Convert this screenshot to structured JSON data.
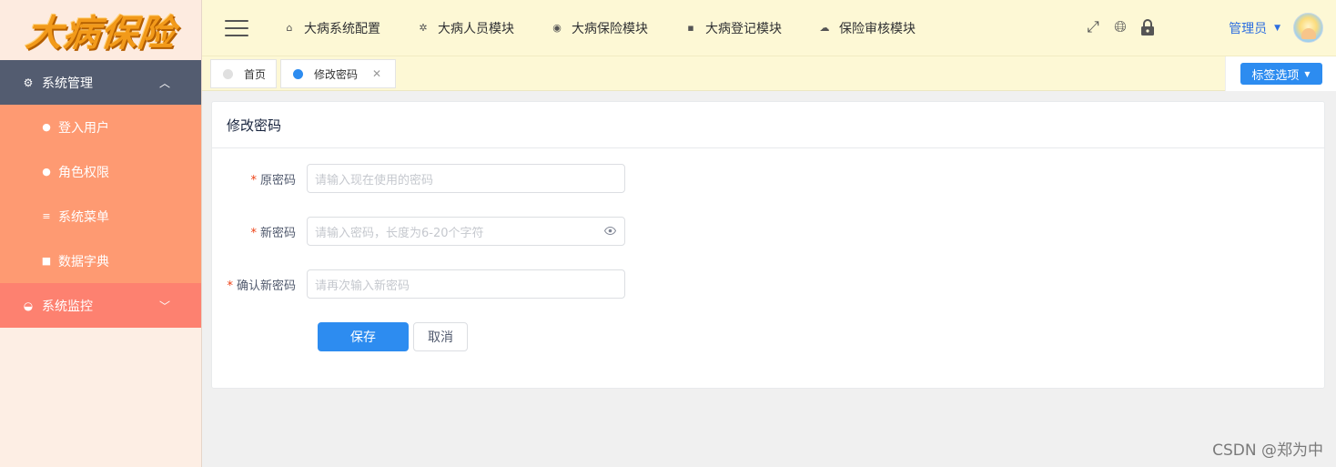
{
  "logo": {
    "text": "大病保险"
  },
  "sidebar": {
    "groups": [
      {
        "label": "系统管理",
        "icon": "gear-icon",
        "expanded": true,
        "items": [
          {
            "label": "登入用户",
            "icon": "user-icon"
          },
          {
            "label": "角色权限",
            "icon": "users-icon"
          },
          {
            "label": "系统菜单",
            "icon": "menu-lines-icon"
          },
          {
            "label": "数据字典",
            "icon": "book-icon"
          }
        ]
      },
      {
        "label": "系统监控",
        "icon": "monitor-dial-icon",
        "expanded": false
      }
    ]
  },
  "header": {
    "nav": [
      {
        "label": "大病系统配置",
        "icon": "home-icon"
      },
      {
        "label": "大病人员模块",
        "icon": "aperture-icon"
      },
      {
        "label": "大病保险模块",
        "icon": "at-circle-icon"
      },
      {
        "label": "大病登记模块",
        "icon": "book-icon"
      },
      {
        "label": "保险审核模块",
        "icon": "cloud-icon"
      }
    ],
    "tools": [
      "fullscreen-icon",
      "globe-icon",
      "lock-icon"
    ],
    "user": {
      "name": "管理员"
    }
  },
  "tabs": [
    {
      "label": "首页",
      "active": false
    },
    {
      "label": "修改密码",
      "active": true,
      "closable": true
    }
  ],
  "tab_options_label": "标签选项",
  "form": {
    "title": "修改密码",
    "fields": [
      {
        "label": "原密码",
        "placeholder": "请输入现在使用的密码",
        "required": true
      },
      {
        "label": "新密码",
        "placeholder": "请输入密码，长度为6-20个字符",
        "required": true,
        "toggle_visibility": true
      },
      {
        "label": "确认新密码",
        "placeholder": "请再次输入新密码",
        "required": true
      }
    ],
    "save_label": "保存",
    "cancel_label": "取消"
  },
  "colors": {
    "sidebar_group_active": "#535c70",
    "sidebar_submenu": "#fe9a72",
    "sidebar_group_monitor": "#fd8170",
    "header_bg": "#fdf8d5",
    "primary": "#2d8cf0"
  },
  "watermark": "CSDN @郑为中"
}
